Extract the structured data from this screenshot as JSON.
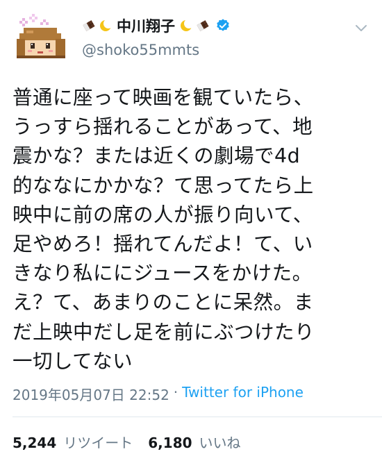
{
  "user": {
    "display_name": "中川翔子",
    "handle": "@shoko55mmts",
    "avatar_icon": "pixel-art-avatar-icon",
    "name_emojis": [
      "chocolate-bar-icon",
      "crescent-moon-icon",
      "crescent-moon-icon",
      "chocolate-bar-icon"
    ]
  },
  "tweet": {
    "text": "普通に座って映画を観ていたら、\nうっすら揺れることがあって、地\n震かな？または近くの劇場で4d\n的ななにかかな？て思ってたら上\n映中に前の席の人が振り向いて、\n足やめろ！揺れてんだよ！て、い\nきなり私ににジュースをかけた。\nえ？て、あまりのことに呆然。ま\nだ上映中だし足を前にぶつけたり\n一切してない",
    "date": "2019年05月07日 22:52",
    "separator": "·",
    "source": "Twitter for iPhone"
  },
  "stats": {
    "retweets_count": "5,244",
    "retweets_label": "リツイート",
    "likes_count": "6,180",
    "likes_label": "いいね"
  },
  "colors": {
    "text": "#14171a",
    "secondary": "#657786",
    "link": "#1da1f2",
    "verified": "#1da1f2"
  }
}
